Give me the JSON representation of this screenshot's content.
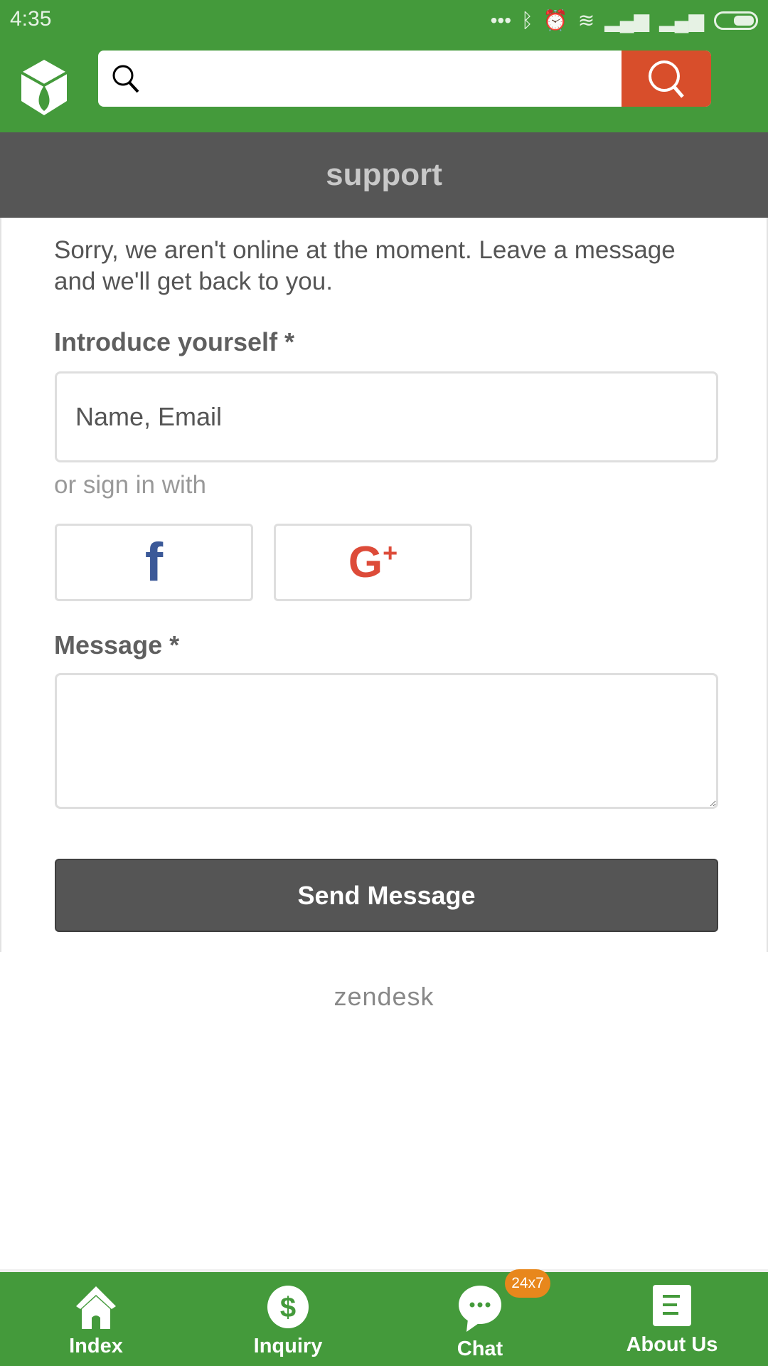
{
  "status_bar": {
    "time": "4:35",
    "icons": [
      "more-dots-icon",
      "bluetooth-icon",
      "alarm-icon",
      "wifi-icon",
      "signal-icon",
      "signal-icon",
      "battery-icon"
    ]
  },
  "header": {
    "search_placeholder": "",
    "search_button_icon": "search-icon"
  },
  "page": {
    "title": "support"
  },
  "form": {
    "intro": "Sorry, we aren't online at the moment. Leave a message and we'll get back to you.",
    "introduce_label": "Introduce yourself *",
    "name_placeholder": "Name, Email",
    "sign_in_text": "or sign in with",
    "message_label": "Message *",
    "message_value": "",
    "send_label": "Send Message"
  },
  "footer": {
    "brand": "zendesk"
  },
  "bottom_nav": {
    "items": [
      {
        "label": "Index",
        "icon": "home-icon"
      },
      {
        "label": "Inquiry",
        "icon": "dollar-icon"
      },
      {
        "label": "Chat",
        "icon": "chat-icon",
        "badge": "24x7"
      },
      {
        "label": "About Us",
        "icon": "document-icon"
      }
    ]
  },
  "colors": {
    "brand_green": "#449a3b",
    "search_button": "#d84e2b",
    "badge": "#e8871c",
    "facebook": "#3b5998",
    "google": "#dd4b39"
  }
}
